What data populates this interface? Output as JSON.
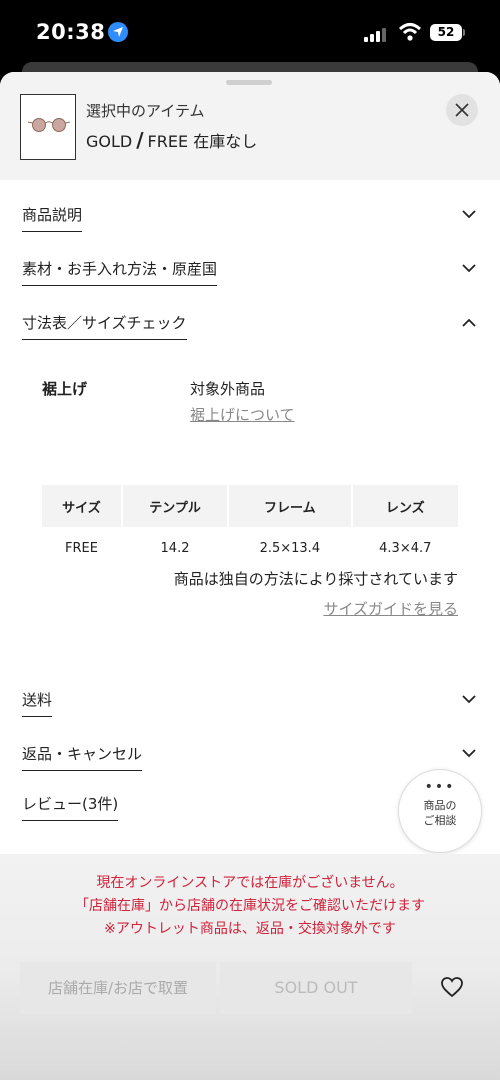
{
  "status": {
    "time": "20:38",
    "battery": "52"
  },
  "header": {
    "title": "選択中のアイテム",
    "color": "GOLD",
    "size": "FREE",
    "stock": "在庫なし"
  },
  "sections": {
    "description": "商品説明",
    "material": "素材・お手入れ方法・原産国",
    "size_chart": "寸法表／サイズチェック",
    "shipping": "送料",
    "returns": "返品・キャンセル",
    "reviews": "レビュー(3件)"
  },
  "fit": {
    "label": "裾上げ",
    "value": "対象外商品",
    "link": "裾上げについて"
  },
  "size_table": {
    "headers": [
      "サイズ",
      "テンプル",
      "フレーム",
      "レンズ"
    ],
    "rows": [
      [
        "FREE",
        "14.2",
        "2.5×13.4",
        "4.3×4.7"
      ]
    ]
  },
  "measure_note": "商品は独自の方法により採寸されています",
  "size_guide": "サイズガイドを見る",
  "consult": {
    "dots": "•••",
    "line1": "商品の",
    "line2": "ご相談"
  },
  "notice": {
    "line1": "現在オンラインストアでは在庫がございません。",
    "line2": "「店舗在庫」から店舗の在庫状況をご確認いただけます",
    "line3": "※アウトレット商品は、返品・交換対象外です"
  },
  "buttons": {
    "store": "店舗在庫/お店で取置",
    "sold_out": "SOLD OUT"
  },
  "colors": {
    "accent_red": "#d0223a",
    "location_blue": "#2f8cff"
  }
}
